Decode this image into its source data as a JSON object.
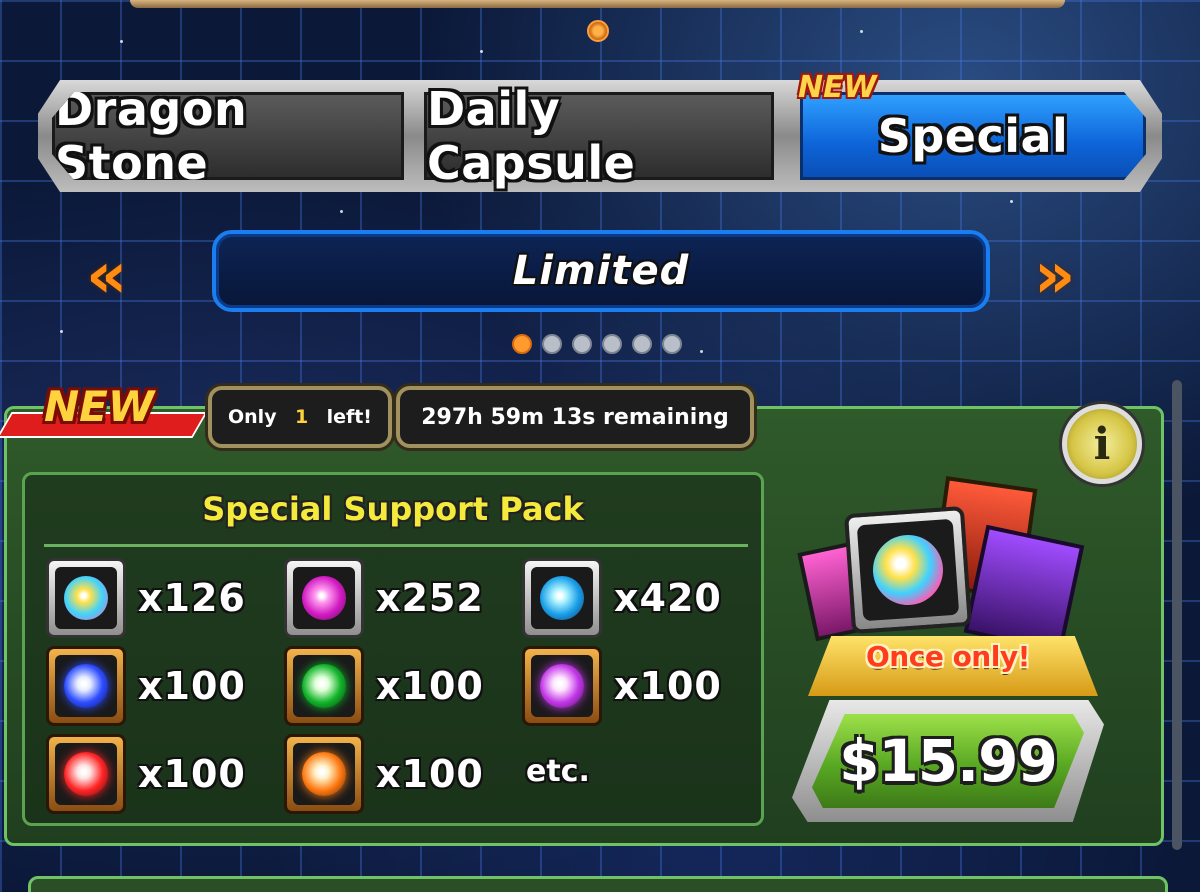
{
  "tabs": [
    {
      "label": "Dragon Stone"
    },
    {
      "label": "Daily Capsule"
    },
    {
      "label": "Special"
    }
  ],
  "tab_new_badge": "NEW",
  "banner": {
    "label": "Limited"
  },
  "pager": {
    "count": 6,
    "active": 0
  },
  "offer": {
    "new_label": "NEW",
    "stock": {
      "prefix": "Only",
      "count": "1",
      "suffix": "left!"
    },
    "remaining": "297h 59m 13s remaining",
    "info_symbol": "i",
    "pack_title": "Special Support Pack",
    "items": [
      {
        "icon": "rainbow-orb-icon",
        "qty": "x126",
        "colors": [
          "#ffe14a",
          "#3fd2ff",
          "#ff5ab3"
        ]
      },
      {
        "icon": "pink-orb-icon",
        "qty": "x252",
        "colors": [
          "#ff9af0",
          "#d21cc2",
          "#5a0a52"
        ]
      },
      {
        "icon": "blue-orb-icon",
        "qty": "x420",
        "colors": [
          "#aef4ff",
          "#1b9fe8",
          "#0a3a6a"
        ]
      },
      {
        "icon": "blue-awakening-medal-icon",
        "qty": "x100",
        "colors": [
          "#e6ecff",
          "#2e4dff",
          "#0a1266"
        ]
      },
      {
        "icon": "green-awakening-medal-icon",
        "qty": "x100",
        "colors": [
          "#dfffd6",
          "#12b42a",
          "#063a0b"
        ]
      },
      {
        "icon": "purple-awakening-medal-icon",
        "qty": "x100",
        "colors": [
          "#ffe3ff",
          "#c238e8",
          "#4a0a5a"
        ]
      },
      {
        "icon": "red-awakening-medal-icon",
        "qty": "x100",
        "colors": [
          "#ffe1e1",
          "#ff2626",
          "#5a0606"
        ]
      },
      {
        "icon": "orange-awakening-medal-icon",
        "qty": "x100",
        "colors": [
          "#fff1c8",
          "#ff7a12",
          "#5a2400"
        ]
      }
    ],
    "etc_label": "etc.",
    "once_label": "Once only!",
    "price": "$15.99"
  }
}
